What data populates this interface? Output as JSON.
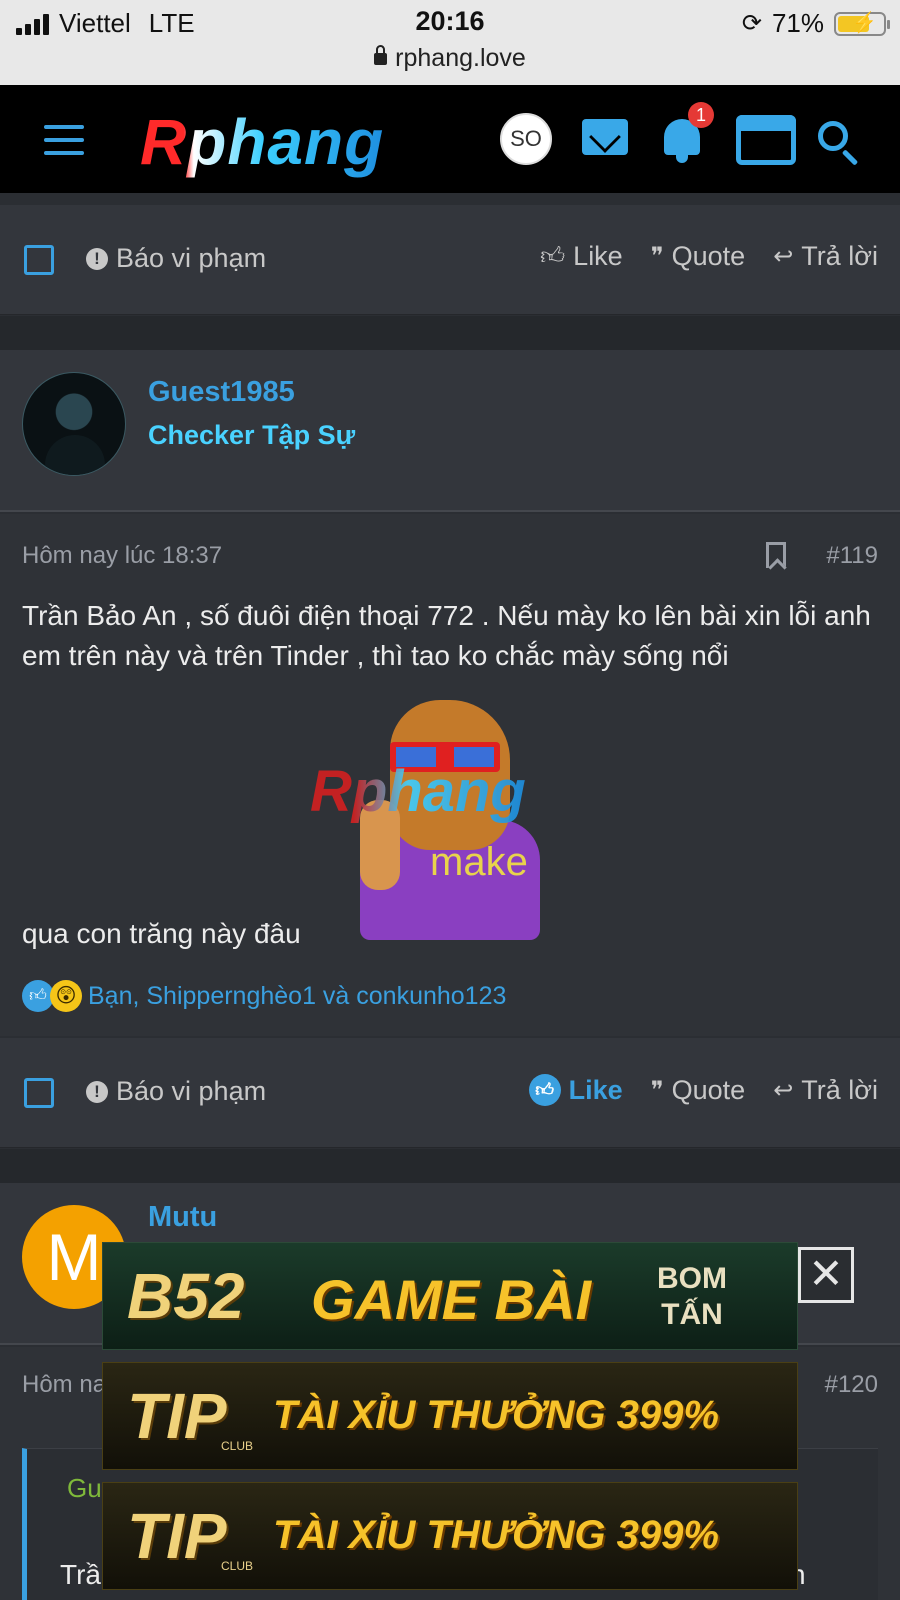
{
  "status_bar": {
    "carrier": "Viettel",
    "network": "LTE",
    "time": "20:16",
    "battery": "71%",
    "battery_level": 0.71,
    "url": "rphang.love"
  },
  "header": {
    "logo": "Rphang",
    "avatar_text": "SO",
    "notification_count": "1",
    "icons": [
      "menu-icon",
      "mail-icon",
      "bell-icon",
      "store-icon",
      "search-icon"
    ],
    "accent": "#39a8e8"
  },
  "actions": {
    "report": "Báo vi phạm",
    "like": "Like",
    "quote": "Quote",
    "reply": "Trả lời"
  },
  "post1": {
    "username": "Guest1985",
    "user_title": "Checker Tập Sự",
    "time": "Hôm nay lúc 18:37",
    "number": "#119",
    "text_line1": "Trần Bảo An , số đuôi điện thoại 772 . Nếu mày ko lên bài xin lỗi anh em trên này và trên Tinder , thì tao ko chắc mày sống nổi",
    "text_line2": "qua con trăng này đâu",
    "sticker_logo": "Rphang",
    "sticker_text": "make",
    "reactions": "Bạn, Shippernghèo1 và conkunho123"
  },
  "post2": {
    "username": "Mutu",
    "avatar_letter": "M",
    "time": "Hôm na",
    "number": "#120",
    "quote_name": "Gue",
    "text_start": "Trầ",
    "text_end": "n"
  },
  "ads": {
    "ad1_brand": "B52",
    "ad1_tagline": "GAME BÀI",
    "ad1_side_top": "BOM",
    "ad1_side_bottom": "TẤN",
    "ad2_brand": "TIP",
    "ad2_club": "CLUB",
    "ad2_tagline": "TÀI XỈU THƯỞNG 399%",
    "ad3_brand": "TIP",
    "ad3_club": "CLUB",
    "ad3_tagline": "TÀI XỈU THƯỞNG 399%",
    "close": "✕"
  }
}
